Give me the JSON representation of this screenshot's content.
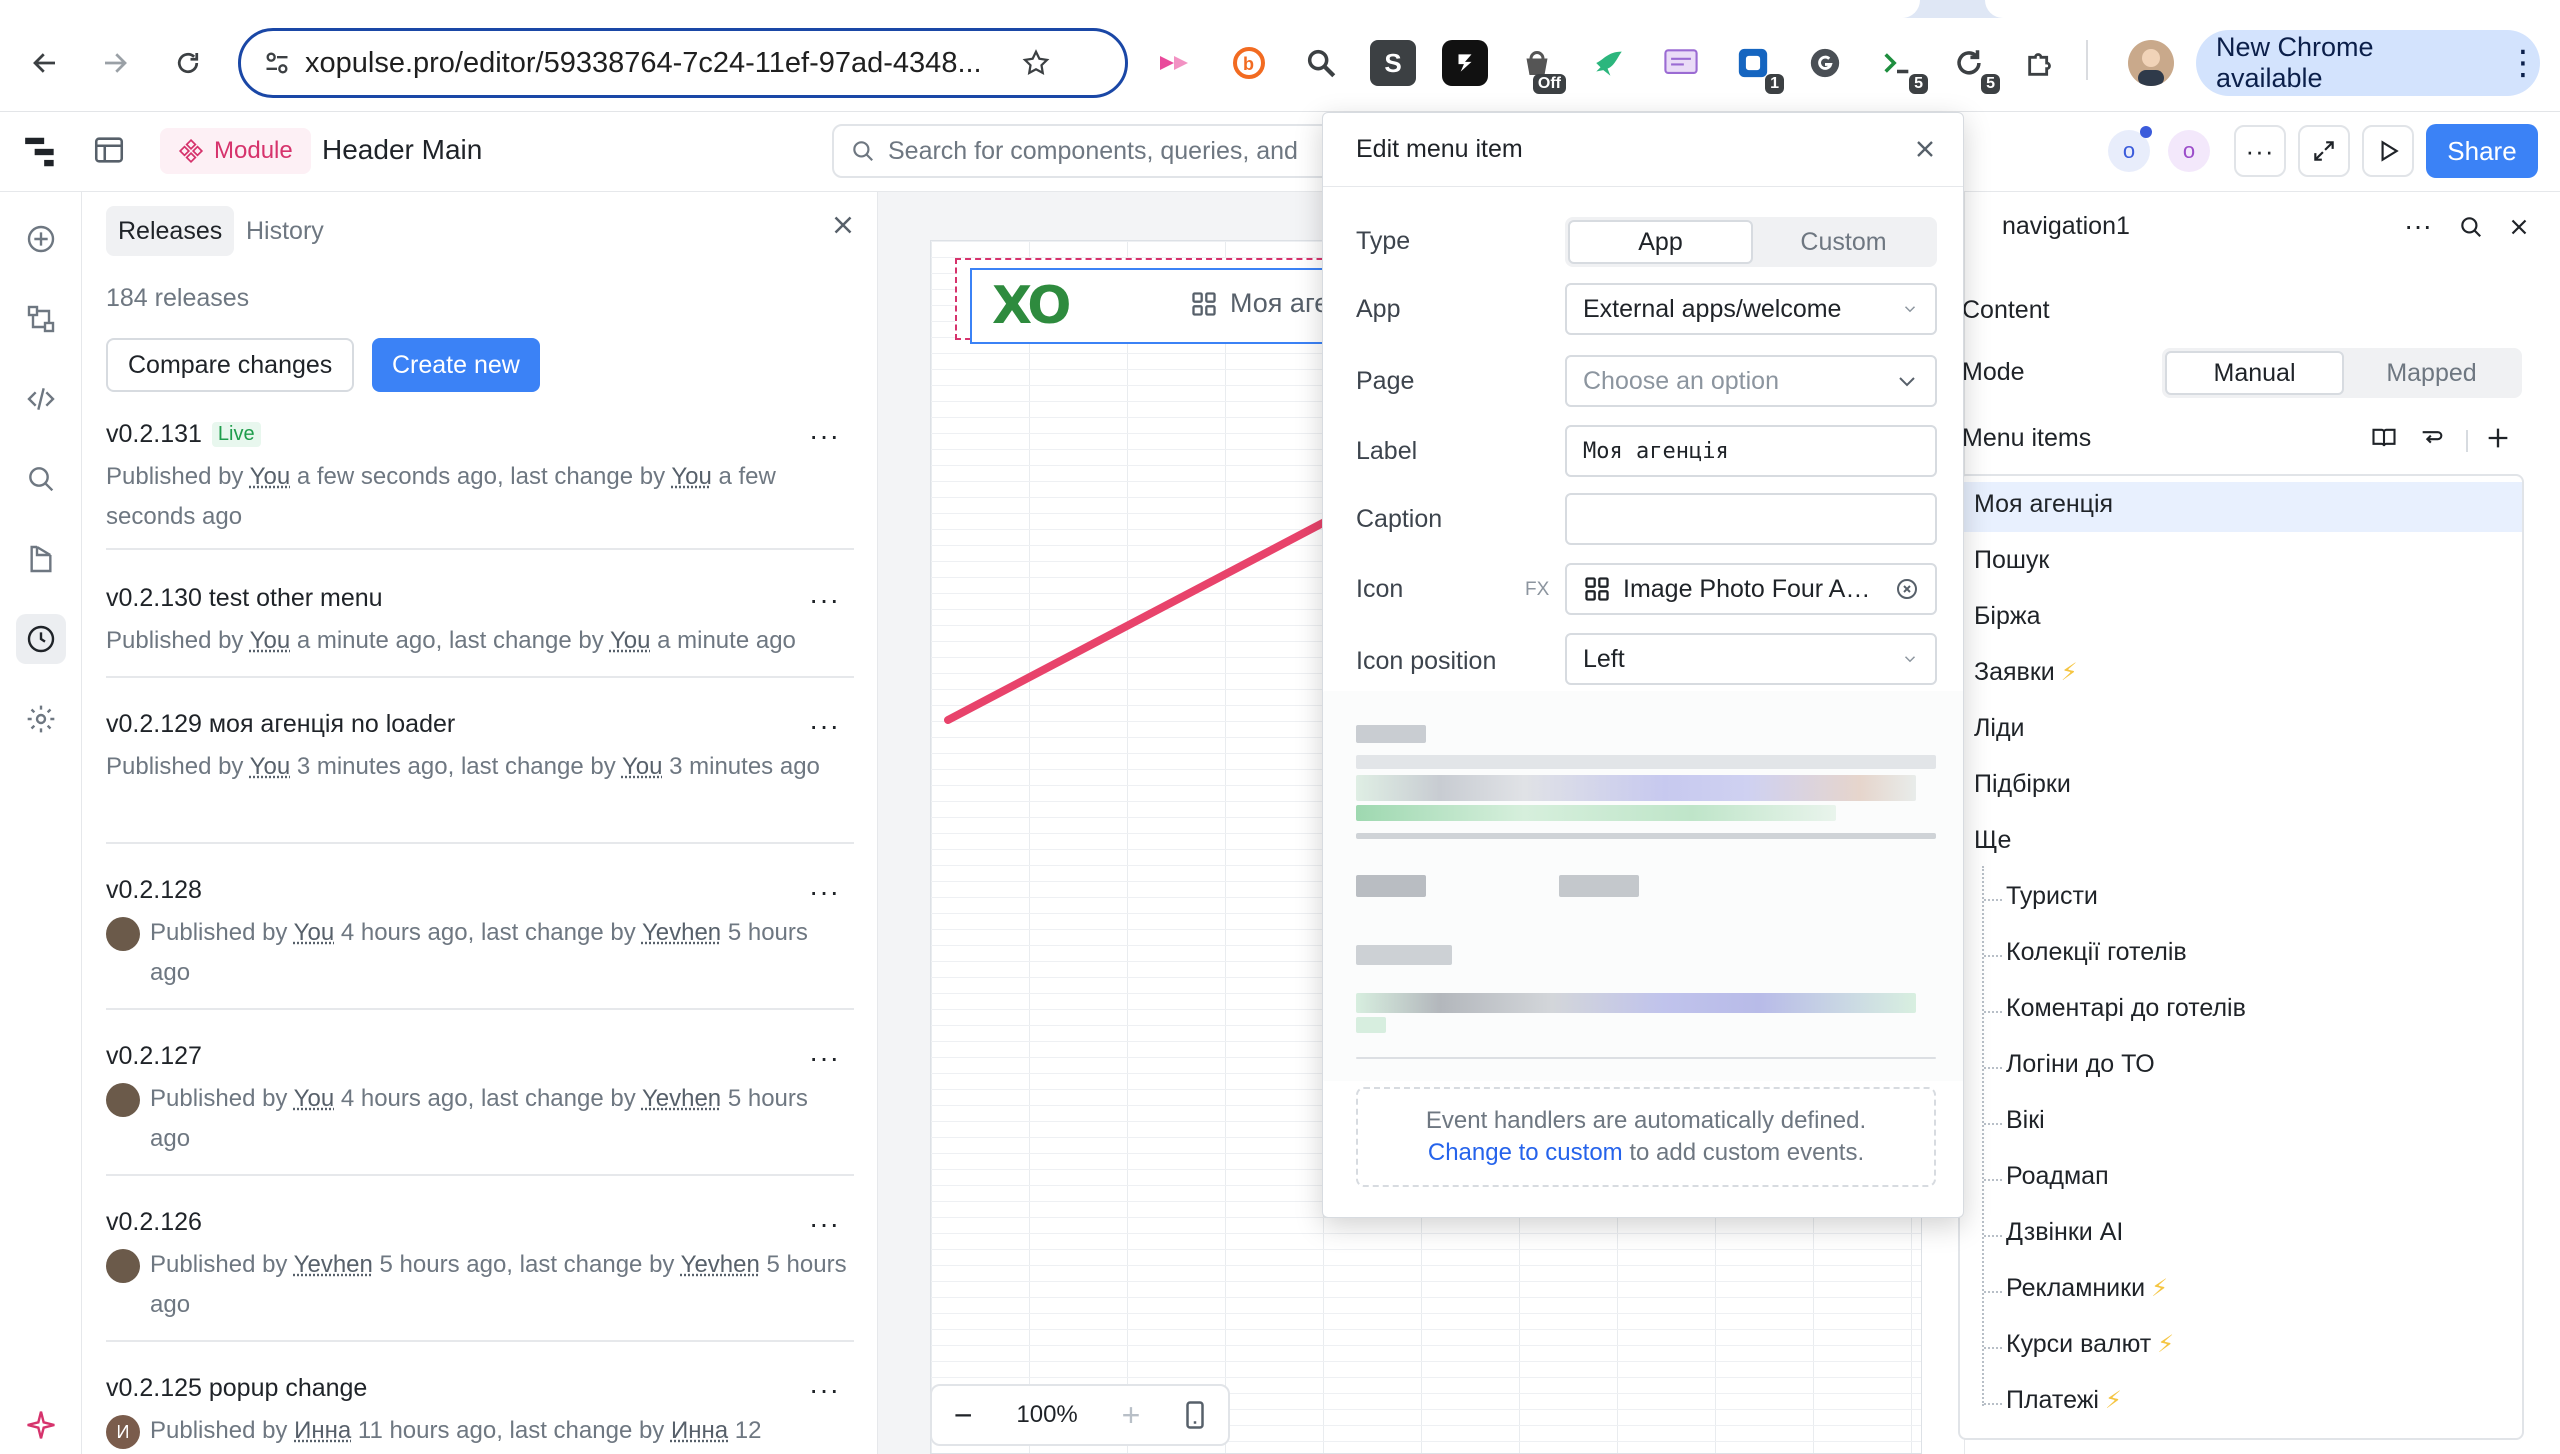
{
  "browser": {
    "url": "xopulse.pro/editor/59338764-7c24-11ef-97ad-4348...",
    "new_chrome_label": "New Chrome available",
    "extensions": [
      {
        "name": "arrow-ext-icon"
      },
      {
        "name": "b-ext-icon"
      },
      {
        "name": "magnifier-ext-icon"
      },
      {
        "name": "s-ext-icon",
        "glyph": "S"
      },
      {
        "name": "pen-ext-icon"
      },
      {
        "name": "off-ext-icon",
        "badge": "Off"
      },
      {
        "name": "bird-ext-icon"
      },
      {
        "name": "translate-ext-icon"
      },
      {
        "name": "counter-ext-icon",
        "badge": "1"
      },
      {
        "name": "grammar-ext-icon"
      },
      {
        "name": "tools-ext-icon",
        "badge": "5"
      },
      {
        "name": "refresh-ext-icon",
        "badge": "5"
      },
      {
        "name": "puzzle-ext-icon"
      }
    ]
  },
  "app": {
    "module_label": "Module",
    "title": "Header Main",
    "search_placeholder": "Search for components, queries, and",
    "share_label": "Share",
    "presence": [
      "o",
      "o"
    ],
    "accent": "#3b82f6"
  },
  "releases": {
    "tabs": [
      "Releases",
      "History"
    ],
    "count": "184 releases",
    "compare_label": "Compare changes",
    "create_label": "Create new",
    "items": [
      {
        "version": "v0.2.131",
        "badge": "Live",
        "meta": [
          "Published by ",
          "You",
          " a few seconds ago, last change by ",
          "You",
          " a few seconds ago"
        ]
      },
      {
        "version": "v0.2.130 test other menu",
        "meta": [
          "Published by ",
          "You",
          " a minute ago, last change by ",
          "You",
          " a minute ago"
        ]
      },
      {
        "version": "v0.2.129 моя агенція no loader",
        "meta": [
          "Published by ",
          "You",
          " 3 minutes ago, last change by ",
          "You",
          " 3 minutes ago"
        ]
      },
      {
        "version": "v0.2.128",
        "meta": [
          "Published by ",
          "You",
          " 4 hours ago, last change by ",
          "Yevhen",
          " 5 hours ago"
        ],
        "avatar": true
      },
      {
        "version": "v0.2.127",
        "meta": [
          "Published by ",
          "You",
          " 4 hours ago, last change by ",
          "Yevhen",
          " 5 hours ago"
        ],
        "avatar": true
      },
      {
        "version": "v0.2.126",
        "meta": [
          "Published by ",
          "Yevhen",
          " 5 hours ago, last change by ",
          "Yevhen",
          " 5 hours ago"
        ],
        "avatar": true
      },
      {
        "version": "v0.2.125 popup change",
        "meta": [
          "Published by ",
          "Инна",
          " 11 hours ago, last change by ",
          "Инна",
          " 12"
        ],
        "avatar": true,
        "avatar_letter": "И"
      }
    ]
  },
  "canvas": {
    "logo_text": "XO",
    "nav_label": "Моя аге",
    "zoom": "100%"
  },
  "modal": {
    "title": "Edit menu item",
    "type_label": "Type",
    "type_options": [
      "App",
      "Custom"
    ],
    "app_label": "App",
    "app_value": "External apps/welcome",
    "page_label": "Page",
    "page_placeholder": "Choose an option",
    "label_label": "Label",
    "label_value": "Моя агенція",
    "caption_label": "Caption",
    "caption_value": "",
    "icon_label": "Icon",
    "icon_fx": "FX",
    "icon_value": "Image Photo Four Alt...",
    "icon_position_label": "Icon position",
    "icon_position_value": "Left",
    "event_note_1": "Event handlers are automatically defined.",
    "event_note_link": "Change to custom",
    "event_note_2": " to add custom events.",
    "annotation_color": "#e8436b"
  },
  "inspector": {
    "component_name": "navigation1",
    "content_label": "Content",
    "mode_label": "Mode",
    "mode_options": [
      "Manual",
      "Mapped"
    ],
    "menu_items_label": "Menu items",
    "items": [
      {
        "label": "Моя агенція",
        "level": 0
      },
      {
        "label": "Пошук",
        "level": 0
      },
      {
        "label": "Біржа",
        "level": 0
      },
      {
        "label": "Заявки",
        "level": 0,
        "bolt": true
      },
      {
        "label": "Ліди",
        "level": 0
      },
      {
        "label": "Підбірки",
        "level": 0
      },
      {
        "label": "Ще",
        "level": 0
      },
      {
        "label": "Туристи",
        "level": 1
      },
      {
        "label": "Колекції готелів",
        "level": 1
      },
      {
        "label": "Коментарі до готелів",
        "level": 1
      },
      {
        "label": "Логіни до ТО",
        "level": 1
      },
      {
        "label": "Вікі",
        "level": 1
      },
      {
        "label": "Роадмап",
        "level": 1
      },
      {
        "label": "Дзвінки AI",
        "level": 1
      },
      {
        "label": "Рекламники",
        "level": 1,
        "bolt": true
      },
      {
        "label": "Курси валют",
        "level": 1,
        "bolt": true
      },
      {
        "label": "Платежі",
        "level": 1,
        "bolt": true
      }
    ]
  }
}
